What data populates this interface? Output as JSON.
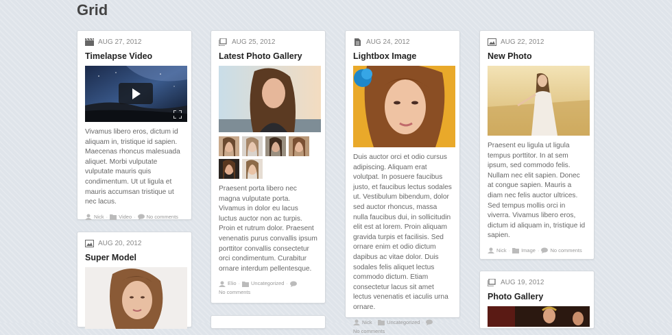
{
  "page": {
    "title": "Grid"
  },
  "posts": [
    {
      "date": "AUG 27, 2012",
      "title": "Timelapse Video",
      "format": "video",
      "excerpt": "Vivamus libero eros, dictum id aliquam in, tristique id sapien. Maecenas rhoncus malesuada aliquet. Morbi vulputate vulputate mauris quis condimentum. Ut ut ligula et mauris accumsan tristique ut nec lacus.",
      "author": "Nick",
      "category": "Video",
      "comments": "No comments"
    },
    {
      "date": "AUG 20, 2012",
      "title": "Super Model",
      "format": "image"
    },
    {
      "date": "AUG 25, 2012",
      "title": "Latest Photo Gallery",
      "format": "gallery",
      "excerpt": "Praesent porta libero nec magna vulputate porta. Vivamus in dolor eu lacus luctus auctor non ac turpis. Proin et rutrum dolor. Praesent venenatis purus convallis ipsum porttitor convallis consectetur orci condimentum. Curabitur ornare interdum pellentesque.",
      "author": "Elio",
      "category": "Uncategorized",
      "comments": "No comments"
    },
    {
      "date": "AUG 24, 2012",
      "title": "Lightbox Image",
      "format": "standard",
      "excerpt": "Duis auctor orci et odio cursus adipiscing. Aliquam erat volutpat. In posuere faucibus justo, et faucibus lectus sodales ut. Vestibulum bibendum, dolor sed auctor rhoncus, massa nulla faucibus dui, in sollicitudin elit est at lorem. Proin aliquam gravida turpis et facilisis. Sed ornare enim et odio dictum dapibus ac vitae dolor. Duis sodales felis aliquet lectus commodo dictum. Etiam consectetur lacus sit amet lectus venenatis et iaculis urna ornare.",
      "author": "Nick",
      "category": "Uncategorized",
      "comments": "No comments"
    },
    {
      "date": "AUG 22, 2012",
      "title": "New Photo",
      "format": "image",
      "excerpt": "Praesent eu ligula ut ligula tempus porttitor. In at sem ipsum, sed commodo felis. Nullam nec elit sapien. Donec at congue sapien. Mauris a diam nec felis auctor ultrices. Sed tempus mollis orci in viverra. Vivamus libero eros, dictum id aliquam in, tristique id sapien.",
      "author": "Nick",
      "category": "Image",
      "comments": "No comments"
    },
    {
      "date": "AUG 19, 2012",
      "title": "Photo Gallery",
      "format": "gallery"
    }
  ],
  "colors": {
    "background": "#dfe4ea",
    "card": "#ffffff",
    "title": "#222222",
    "meta": "#888888"
  },
  "icons": {
    "video": "clapperboard-icon",
    "image": "picture-icon",
    "gallery": "gallery-icon",
    "standard": "document-icon",
    "author": "user-icon",
    "category": "folder-icon",
    "comments": "comment-icon",
    "play": "play-icon",
    "fullscreen": "fullscreen-icon"
  }
}
